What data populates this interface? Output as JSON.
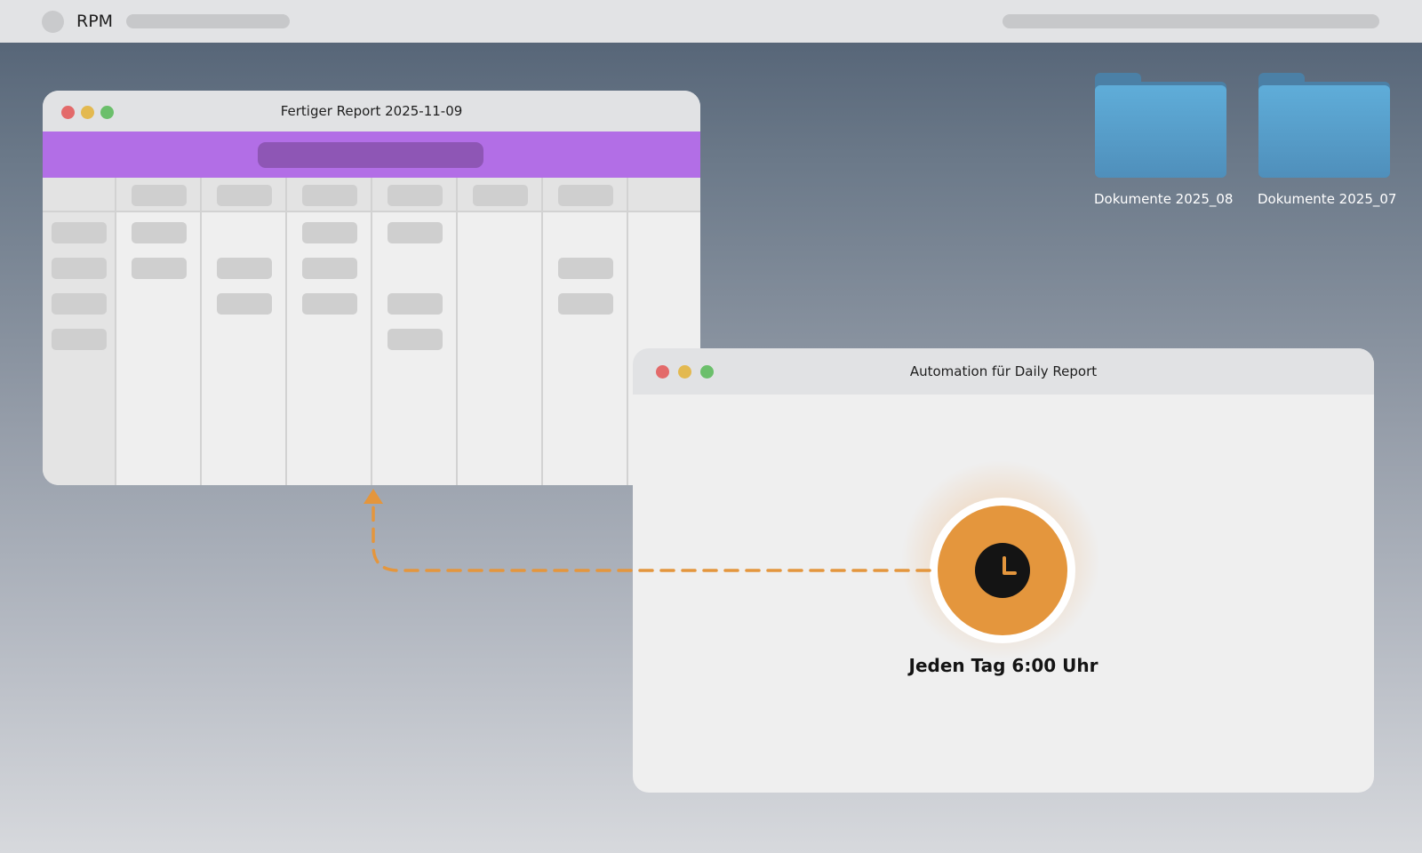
{
  "menubar": {
    "app_name": "RPM"
  },
  "desktop": {
    "folders": [
      {
        "label": "Dokumente 2025_08",
        "icon": "folder-icon"
      },
      {
        "label": "Dokumente 2025_07",
        "icon": "folder-icon"
      }
    ]
  },
  "report_window": {
    "title": "Fertiger Report 2025-11-09",
    "accent_color": "#b26ee6"
  },
  "automation_window": {
    "title": "Automation für Daily Report",
    "schedule_label": "Jeden Tag 6:00 Uhr",
    "trigger_icon": "clock-icon",
    "accent_color": "#e4963d"
  },
  "window_controls": {
    "close_color": "#e36a6a",
    "minimize_color": "#e3b950",
    "maximize_color": "#6bbf6b"
  }
}
